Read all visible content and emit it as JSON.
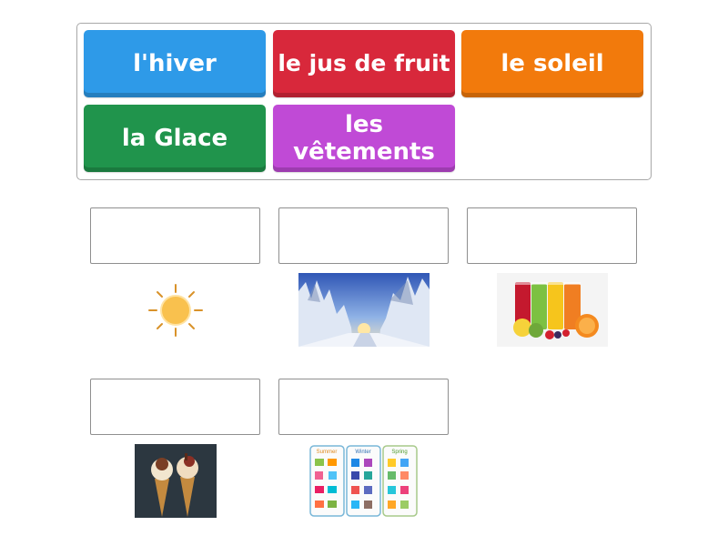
{
  "tiles": [
    {
      "label": "l'hiver",
      "color": "#2e9ae8"
    },
    {
      "label": "le jus de fruit",
      "color": "#d8283b"
    },
    {
      "label": "le soleil",
      "color": "#f27a0c"
    },
    {
      "label": "la Glace",
      "color": "#20944c"
    },
    {
      "label": "les vêtements",
      "color": "#c04ad6"
    }
  ],
  "images": [
    {
      "icon": "sun-icon"
    },
    {
      "icon": "winter-forest-image"
    },
    {
      "icon": "fruit-juice-image"
    },
    {
      "icon": "ice-cream-image"
    },
    {
      "icon": "clothes-chart-image"
    }
  ],
  "clothes_chart": {
    "columns": [
      "Summer",
      "Winter",
      "Spring"
    ]
  }
}
